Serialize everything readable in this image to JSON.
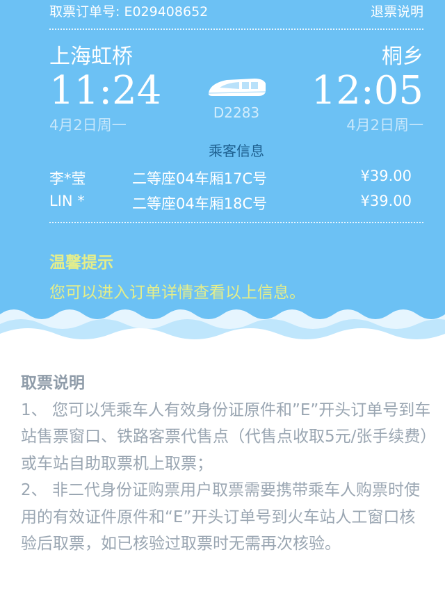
{
  "header": {
    "order_label": "取票订单号: E029408652",
    "refund_link": "退票说明"
  },
  "trip": {
    "from_station": "上海虹桥",
    "to_station": "桐乡",
    "depart_time": "11:24",
    "arrive_time": "12:05",
    "depart_date": "4月2日周一",
    "arrive_date": "4月2日周一",
    "train_no": "D2283",
    "train_icon": "train-icon"
  },
  "passengers": {
    "title": "乘客信息",
    "items": [
      {
        "name": "李*莹",
        "seat": "二等座04车厢17C号",
        "price": "¥39.00"
      },
      {
        "name": "LIN *",
        "seat": "二等座04车厢18C号",
        "price": "¥39.00"
      }
    ]
  },
  "tip": {
    "title": "温馨提示",
    "text": "您可以进入订单详情查看以上信息。"
  },
  "notice": {
    "title": "取票说明",
    "item1": "1、 您可以凭乘车人有效身份证原件和”E”开头订单号到车站售票窗口、铁路客票代售点（代售点收取5元/张手续费）或车站自助取票机上取票；",
    "item2": "2、 非二代身份证购票用户取票需要携带乘车人购票时使用的有效证件原件和“E”开头订单号到火车站人工窗口核验后取票，如已核验过取票时无需再次核验。"
  },
  "colors": {
    "ticket_bg": "#6cc1f4",
    "tip": "#e5ee8a",
    "notice_text": "#9aa6b2",
    "passenger_title": "#1d5f8f"
  }
}
